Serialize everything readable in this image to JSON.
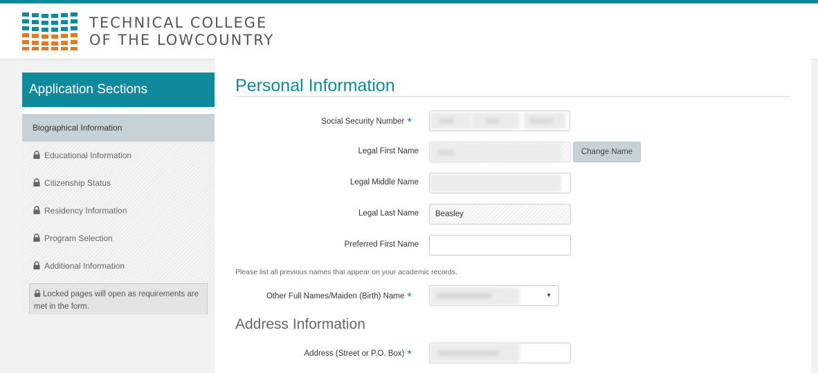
{
  "header": {
    "logo_line1": "TECHNICAL COLLEGE",
    "logo_line2": "OF THE LOWCOUNTRY",
    "icon": "college-grid-logo"
  },
  "colors": {
    "accent": "#0f8a9d",
    "orange": "#e07b24",
    "active_item": "#c6d2d8"
  },
  "sidebar": {
    "title": "Application Sections",
    "items": [
      {
        "label": "Biographical Information",
        "locked": false,
        "active": true
      },
      {
        "label": "Educational Information",
        "locked": true
      },
      {
        "label": "Citizenship Status",
        "locked": true
      },
      {
        "label": "Residency Information",
        "locked": true
      },
      {
        "label": "Program Selection",
        "locked": true
      },
      {
        "label": "Additional Information",
        "locked": true
      }
    ],
    "note": "Locked pages will open as requirements are met in the form."
  },
  "main": {
    "section_title": "Personal Information",
    "fields": {
      "ssn_label": "Social Security Number",
      "first_label": "Legal First Name",
      "change_name": "Change Name",
      "middle_label": "Legal Middle Name",
      "last_label": "Legal Last Name",
      "last_value": "Beasley",
      "preferred_label": "Preferred First Name",
      "hint": "Please list all previous names that appear on your academic records.",
      "other_names_label": "Other Full Names/Maiden (Birth) Name"
    },
    "address_title": "Address Information",
    "address_label": "Address (Street or P.O. Box)"
  }
}
